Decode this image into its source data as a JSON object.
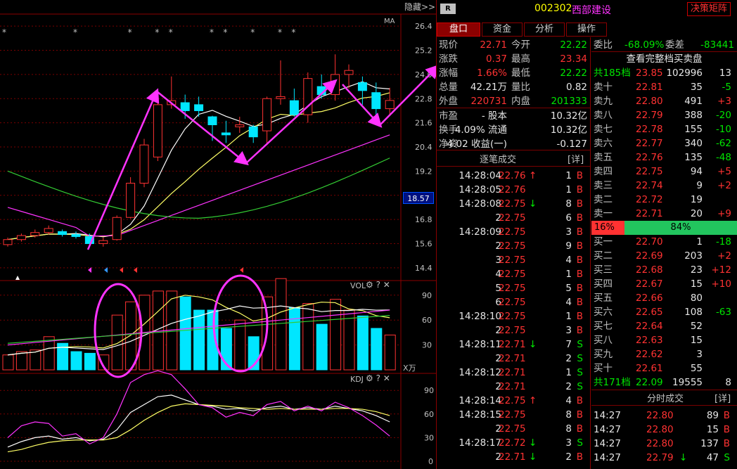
{
  "chart": {
    "hide_label": "隐藏>>",
    "ma_label": "MA",
    "price_ticks": [
      "26.4",
      "25.2",
      "24.0",
      "22.8",
      "21.6",
      "20.4",
      "19.2",
      "18.0",
      "16.8",
      "15.6",
      "14.4"
    ],
    "current_price_tag": "18.57",
    "vol": {
      "label": "VOL",
      "ticks": [
        "90",
        "60",
        "30"
      ],
      "unit": "X万"
    },
    "kdj": {
      "label": "KDJ",
      "ticks": [
        "90",
        "60",
        "30",
        "0"
      ]
    },
    "candles": [
      {
        "o": 15.55,
        "c": 15.8,
        "h": 15.9,
        "l": 15.45,
        "v": 18
      },
      {
        "o": 15.8,
        "c": 16.0,
        "h": 16.1,
        "l": 15.7,
        "v": 22
      },
      {
        "o": 16.0,
        "c": 16.15,
        "h": 16.3,
        "l": 15.9,
        "v": 24
      },
      {
        "o": 16.15,
        "c": 16.35,
        "h": 16.5,
        "l": 16.05,
        "v": 40
      },
      {
        "o": 16.2,
        "c": 16.05,
        "h": 16.3,
        "l": 15.95,
        "v": 32
      },
      {
        "o": 16.05,
        "c": 15.95,
        "h": 16.2,
        "l": 15.85,
        "v": 22
      },
      {
        "o": 15.95,
        "c": 15.6,
        "h": 16.1,
        "l": 15.5,
        "v": 20
      },
      {
        "o": 15.6,
        "c": 15.75,
        "h": 15.9,
        "l": 15.45,
        "v": 18
      },
      {
        "o": 15.8,
        "c": 16.9,
        "h": 17.0,
        "l": 15.75,
        "v": 66
      },
      {
        "o": 16.9,
        "c": 18.6,
        "h": 18.9,
        "l": 16.85,
        "v": 82
      },
      {
        "o": 18.6,
        "c": 20.5,
        "h": 20.8,
        "l": 18.4,
        "v": 90
      },
      {
        "o": 19.9,
        "c": 22.5,
        "h": 22.6,
        "l": 19.7,
        "v": 95
      },
      {
        "o": 22.5,
        "c": 22.7,
        "h": 23.9,
        "l": 22.3,
        "v": 95
      },
      {
        "o": 22.6,
        "c": 22.2,
        "h": 23.0,
        "l": 21.8,
        "v": 88
      },
      {
        "o": 22.5,
        "c": 22.2,
        "h": 22.9,
        "l": 21.9,
        "v": 72
      },
      {
        "o": 21.9,
        "c": 21.5,
        "h": 21.95,
        "l": 20.7,
        "v": 72
      },
      {
        "o": 21.1,
        "c": 21.0,
        "h": 21.7,
        "l": 20.6,
        "v": 50
      },
      {
        "o": 21.4,
        "c": 21.5,
        "h": 21.9,
        "l": 21.1,
        "v": 60
      },
      {
        "o": 21.4,
        "c": 20.9,
        "h": 21.5,
        "l": 20.6,
        "v": 40
      },
      {
        "o": 21.2,
        "c": 22.8,
        "h": 22.9,
        "l": 20.6,
        "v": 88
      },
      {
        "o": 22.8,
        "c": 22.9,
        "h": 24.7,
        "l": 22.5,
        "v": 110
      },
      {
        "o": 22.7,
        "c": 22.0,
        "h": 23.3,
        "l": 21.9,
        "v": 75
      },
      {
        "o": 22.0,
        "c": 23.8,
        "h": 24.1,
        "l": 21.6,
        "v": 80
      },
      {
        "o": 23.4,
        "c": 23.0,
        "h": 24.0,
        "l": 22.8,
        "v": 55
      },
      {
        "o": 23.0,
        "c": 24.0,
        "h": 25.0,
        "l": 22.7,
        "v": 85
      },
      {
        "o": 24.0,
        "c": 24.2,
        "h": 24.5,
        "l": 23.3,
        "v": 72
      },
      {
        "o": 23.6,
        "c": 23.2,
        "h": 23.9,
        "l": 22.5,
        "v": 65
      },
      {
        "o": 23.1,
        "c": 22.3,
        "h": 23.6,
        "l": 22.0,
        "v": 50
      },
      {
        "o": 22.3,
        "c": 22.71,
        "h": 23.34,
        "l": 22.0,
        "v": 42
      }
    ]
  },
  "header": {
    "badge": "R",
    "code": "002302",
    "name": "西部建设",
    "matrix_button": "决策矩阵"
  },
  "tabs": [
    "盘口",
    "资金",
    "分析",
    "操作"
  ],
  "quote": [
    {
      "l1": "现价",
      "v1": "22.71",
      "c1": "red",
      "l2": "今开",
      "v2": "22.22",
      "c2": "grn"
    },
    {
      "l1": "涨跌",
      "v1": "0.37",
      "c1": "red",
      "l2": "最高",
      "v2": "23.34",
      "c2": "red"
    },
    {
      "l1": "涨幅",
      "v1": "1.66%",
      "c1": "red",
      "l2": "最低",
      "v2": "22.22",
      "c2": "grn"
    },
    {
      "l1": "总量",
      "v1": "42.21万",
      "c1": "wht",
      "l2": "量比",
      "v2": "0.82",
      "c2": "wht"
    },
    {
      "l1": "外盘",
      "v1": "220731",
      "c1": "red",
      "l2": "内盘",
      "v2": "201333",
      "c2": "grn"
    },
    {
      "l1": "市盈",
      "v1": "- 股本",
      "c1": "wht",
      "l2": "",
      "v2": "10.32亿",
      "c2": "wht"
    },
    {
      "l1": "换手",
      "v1": "4.09% 流通",
      "c1": "wht",
      "l2": "",
      "v2": "10.32亿",
      "c2": "wht"
    },
    {
      "l1": "净资",
      "v1": "4.02 收益(一)",
      "c1": "wht",
      "l2": "",
      "v2": "-0.127",
      "c2": "wht"
    }
  ],
  "ticks_panel": {
    "title": "逐笔成交",
    "detail": "[详]"
  },
  "trades": [
    {
      "t": "14:28:04",
      "p": "22.76",
      "a": "↑",
      "n": "1",
      "s": "B"
    },
    {
      "t": "14:28:05",
      "p": "22.76",
      "a": "",
      "n": "1",
      "s": "B"
    },
    {
      "t": "14:28:08",
      "p": "22.75",
      "a": "↓",
      "n": "8",
      "s": "B"
    },
    {
      "t": "2",
      "p": "22.75",
      "a": "",
      "n": "6",
      "s": "B"
    },
    {
      "t": "14:28:09",
      "p": "22.75",
      "a": "",
      "n": "3",
      "s": "B"
    },
    {
      "t": "2",
      "p": "22.75",
      "a": "",
      "n": "9",
      "s": "B"
    },
    {
      "t": "3",
      "p": "22.75",
      "a": "",
      "n": "4",
      "s": "B"
    },
    {
      "t": "4",
      "p": "22.75",
      "a": "",
      "n": "1",
      "s": "B"
    },
    {
      "t": "5",
      "p": "22.75",
      "a": "",
      "n": "5",
      "s": "B"
    },
    {
      "t": "6",
      "p": "22.75",
      "a": "",
      "n": "4",
      "s": "B"
    },
    {
      "t": "14:28:10",
      "p": "22.75",
      "a": "",
      "n": "1",
      "s": "B"
    },
    {
      "t": "2",
      "p": "22.75",
      "a": "",
      "n": "3",
      "s": "B"
    },
    {
      "t": "14:28:11",
      "p": "22.71",
      "a": "↓",
      "n": "7",
      "s": "S"
    },
    {
      "t": "2",
      "p": "22.71",
      "a": "",
      "n": "2",
      "s": "S"
    },
    {
      "t": "14:28:12",
      "p": "22.71",
      "a": "",
      "n": "1",
      "s": "S"
    },
    {
      "t": "2",
      "p": "22.71",
      "a": "",
      "n": "2",
      "s": "S"
    },
    {
      "t": "14:28:14",
      "p": "22.75",
      "a": "↑",
      "n": "4",
      "s": "B"
    },
    {
      "t": "14:28:15",
      "p": "22.75",
      "a": "",
      "n": "8",
      "s": "B"
    },
    {
      "t": "2",
      "p": "22.75",
      "a": "",
      "n": "8",
      "s": "B"
    },
    {
      "t": "14:28:17",
      "p": "22.72",
      "a": "↓",
      "n": "3",
      "s": "S"
    },
    {
      "t": "2",
      "p": "22.71",
      "a": "↓",
      "n": "2",
      "s": "B"
    }
  ],
  "orderbook": {
    "wei_label": "委比",
    "wei_value": "-68.09%",
    "wei_diff_label": "委差",
    "wei_diff_value": "-83441",
    "view_full": "查看完整档买卖盘",
    "top": {
      "label": "共185档",
      "price": "23.85",
      "vol": "102996",
      "cnt": "13"
    },
    "asks": [
      {
        "l": "卖十",
        "p": "22.81",
        "v": "35",
        "ch": "-5"
      },
      {
        "l": "卖九",
        "p": "22.80",
        "v": "491",
        "ch": "+3"
      },
      {
        "l": "卖八",
        "p": "22.79",
        "v": "388",
        "ch": "-20"
      },
      {
        "l": "卖七",
        "p": "22.78",
        "v": "155",
        "ch": "-10"
      },
      {
        "l": "卖六",
        "p": "22.77",
        "v": "340",
        "ch": "-62"
      },
      {
        "l": "卖五",
        "p": "22.76",
        "v": "135",
        "ch": "-48"
      },
      {
        "l": "卖四",
        "p": "22.75",
        "v": "94",
        "ch": "+5"
      },
      {
        "l": "卖三",
        "p": "22.74",
        "v": "9",
        "ch": "+2"
      },
      {
        "l": "卖二",
        "p": "22.72",
        "v": "19",
        "ch": ""
      },
      {
        "l": "卖一",
        "p": "22.71",
        "v": "20",
        "ch": "+9"
      }
    ],
    "ratio": {
      "buy": "16%",
      "sell": "84%",
      "buy_fraction": 0.16
    },
    "bids": [
      {
        "l": "买一",
        "p": "22.70",
        "v": "1",
        "ch": "-18"
      },
      {
        "l": "买二",
        "p": "22.69",
        "v": "203",
        "ch": "+2"
      },
      {
        "l": "买三",
        "p": "22.68",
        "v": "23",
        "ch": "+12"
      },
      {
        "l": "买四",
        "p": "22.67",
        "v": "15",
        "ch": "+10"
      },
      {
        "l": "买五",
        "p": "22.66",
        "v": "80",
        "ch": ""
      },
      {
        "l": "买六",
        "p": "22.65",
        "v": "108",
        "ch": "-63"
      },
      {
        "l": "买七",
        "p": "22.64",
        "v": "52",
        "ch": ""
      },
      {
        "l": "买八",
        "p": "22.63",
        "v": "15",
        "ch": ""
      },
      {
        "l": "买九",
        "p": "22.62",
        "v": "3",
        "ch": ""
      },
      {
        "l": "买十",
        "p": "22.61",
        "v": "55",
        "ch": ""
      }
    ],
    "bottom": {
      "label": "共171档",
      "price": "22.09",
      "vol": "19555",
      "cnt": "8"
    }
  },
  "fenshi": {
    "title": "分时成交",
    "detail": "[详]",
    "rows": [
      {
        "t": "14:27",
        "p": "22.80",
        "a": "",
        "v": "89",
        "s": "B"
      },
      {
        "t": "14:27",
        "p": "22.80",
        "a": "",
        "v": "15",
        "s": "B"
      },
      {
        "t": "14:27",
        "p": "22.80",
        "a": "",
        "v": "137",
        "s": "B"
      },
      {
        "t": "14:27",
        "p": "22.79",
        "a": "↓",
        "v": "47",
        "s": "S"
      }
    ]
  },
  "colors": {
    "up": "#ff3232",
    "down": "#00e6ff",
    "bg": "#000000",
    "grid": "#8b0000",
    "accent": "#ff33ff"
  }
}
